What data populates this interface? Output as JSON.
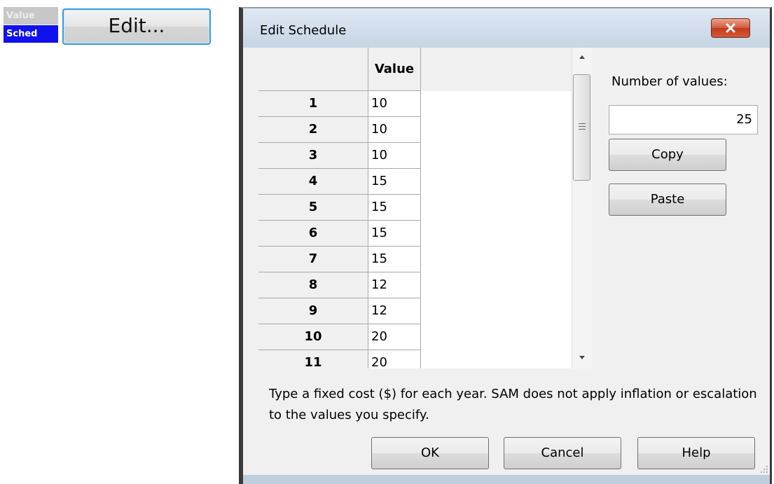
{
  "widget": {
    "value_label": "Value",
    "sched_label": "Sched",
    "edit_button_label": "Edit..."
  },
  "dialog": {
    "title": "Edit Schedule",
    "close_icon": "close-x-icon",
    "grid": {
      "column_header": "Value",
      "rows": [
        {
          "index": "1",
          "value": "10"
        },
        {
          "index": "2",
          "value": "10"
        },
        {
          "index": "3",
          "value": "10"
        },
        {
          "index": "4",
          "value": "15"
        },
        {
          "index": "5",
          "value": "15"
        },
        {
          "index": "6",
          "value": "15"
        },
        {
          "index": "7",
          "value": "15"
        },
        {
          "index": "8",
          "value": "12"
        },
        {
          "index": "9",
          "value": "12"
        },
        {
          "index": "10",
          "value": "20"
        },
        {
          "index": "11",
          "value": "20"
        }
      ]
    },
    "number_of_values_label": "Number of values:",
    "number_of_values": "25",
    "copy_label": "Copy",
    "paste_label": "Paste",
    "help_text": "Type a fixed cost ($) for each year. SAM does not apply inflation or escalation to the values you specify.",
    "ok_label": "OK",
    "cancel_label": "Cancel",
    "help_label": "Help"
  },
  "colors": {
    "sched_active": "#1111ee",
    "close_button": "#c33a1c",
    "focus_border": "#3c9ad7"
  }
}
